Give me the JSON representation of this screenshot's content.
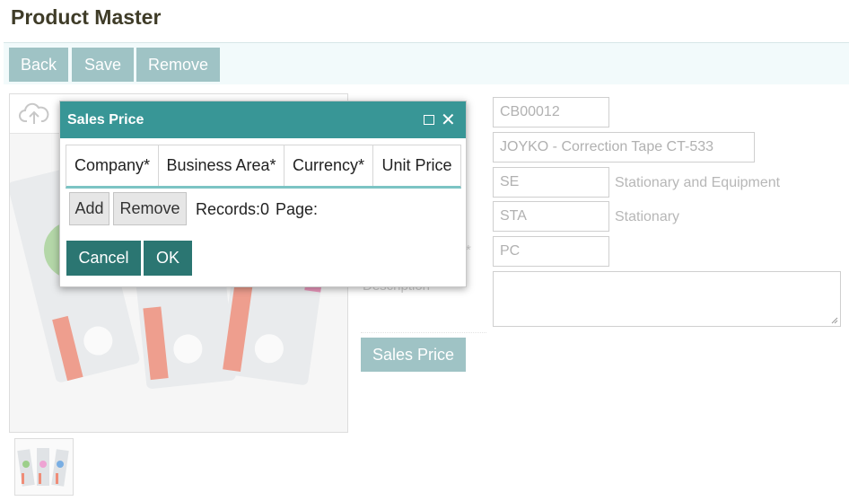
{
  "page": {
    "title": "Product Master"
  },
  "toolbar": {
    "back_label": "Back",
    "save_label": "Save",
    "remove_label": "Remove"
  },
  "form": {
    "product_code": "CB00012",
    "product_name": "JOYKO - Correction Tape CT-533",
    "category_code": "SE",
    "category_name": "Stationary and Equipment",
    "group_code": "STA",
    "group_name": "Stationary",
    "unit_code": "PC",
    "unit_label_suffix": "*",
    "description_label": "Description",
    "description_value": "",
    "sales_price_button": "Sales Price"
  },
  "dialog": {
    "title": "Sales Price",
    "columns": [
      "Company*",
      "Business Area*",
      "Currency*",
      "Unit Price"
    ],
    "add_label": "Add",
    "remove_label": "Remove",
    "records_text": "Records:0",
    "page_text": "Page:",
    "cancel_label": "Cancel",
    "ok_label": "OK"
  },
  "colors": {
    "dialog_header": "#389696",
    "primary_button": "#2b7672",
    "toolbar_button": "#9fc3c5",
    "grid_underline": "#7cc4c4"
  },
  "icons": {
    "upload": "cloud-upload-icon",
    "maximize": "maximize-icon",
    "close": "close-icon"
  }
}
